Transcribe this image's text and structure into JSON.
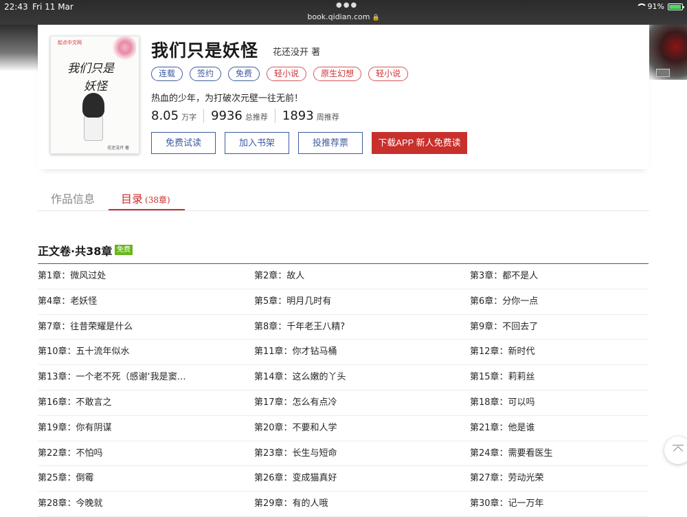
{
  "status": {
    "time": "22:43",
    "date": "Fri 11 Mar",
    "battery": "91%"
  },
  "browser": {
    "url": "book.qidian.com"
  },
  "book": {
    "cover_logo": "起点中文网",
    "cover_title_line1": "我们只是",
    "cover_title_line2": "妖怪",
    "cover_author": "花还没开 著",
    "title": "我们只是妖怪",
    "author": "花还没开 著",
    "tags": [
      {
        "label": "连载",
        "style": "blue"
      },
      {
        "label": "签约",
        "style": "blue"
      },
      {
        "label": "免费",
        "style": "blue"
      },
      {
        "label": "轻小说",
        "style": "red"
      },
      {
        "label": "原生幻想",
        "style": "red"
      },
      {
        "label": "轻小说",
        "style": "red"
      }
    ],
    "intro": "热血的少年，为打破次元壁一往无前！",
    "stats": [
      {
        "value": "8.05",
        "unit": "万字"
      },
      {
        "value": "9936",
        "unit": "总推荐"
      },
      {
        "value": "1893",
        "unit": "周推荐"
      }
    ],
    "actions": {
      "read": "免费试读",
      "shelf": "加入书架",
      "vote": "投推荐票",
      "app": "下载APP 新人免费读"
    }
  },
  "tabs": {
    "info": "作品信息",
    "toc": "目录",
    "toc_count": "(38章)"
  },
  "volume": {
    "title": "正文卷·共38章",
    "badge": "免费"
  },
  "chapters": [
    [
      "第1章：微风过处",
      "第2章：故人",
      "第3章：都不是人"
    ],
    [
      "第4章：老妖怪",
      "第5章：明月几时有",
      "第6章：分你一点"
    ],
    [
      "第7章：往昔荣耀是什么",
      "第8章：千年老王八精?",
      "第9章：不回去了"
    ],
    [
      "第10章：五十流年似水",
      "第11章：你才钻马桶",
      "第12章：新时代"
    ],
    [
      "第13章：一个老不死（感谢‘我是窦…",
      "第14章：这么嫩的丫头",
      "第15章：莉莉丝"
    ],
    [
      "第16章：不敢言之",
      "第17章：怎么有点冷",
      "第18章：可以吗"
    ],
    [
      "第19章：你有阴谋",
      "第20章：不要和人学",
      "第21章：他是谁"
    ],
    [
      "第22章：不怕吗",
      "第23章：长生与短命",
      "第24章：需要看医生"
    ],
    [
      "第25章：倒霉",
      "第26章：变成猫真好",
      "第27章：劳动光荣"
    ],
    [
      "第28章：今晚就",
      "第29章：有的人哦",
      "第30章：记一万年"
    ]
  ],
  "colors": {
    "accent": "#c8302c",
    "link_blue": "#3d5a9e",
    "free_green": "#69b61d"
  }
}
